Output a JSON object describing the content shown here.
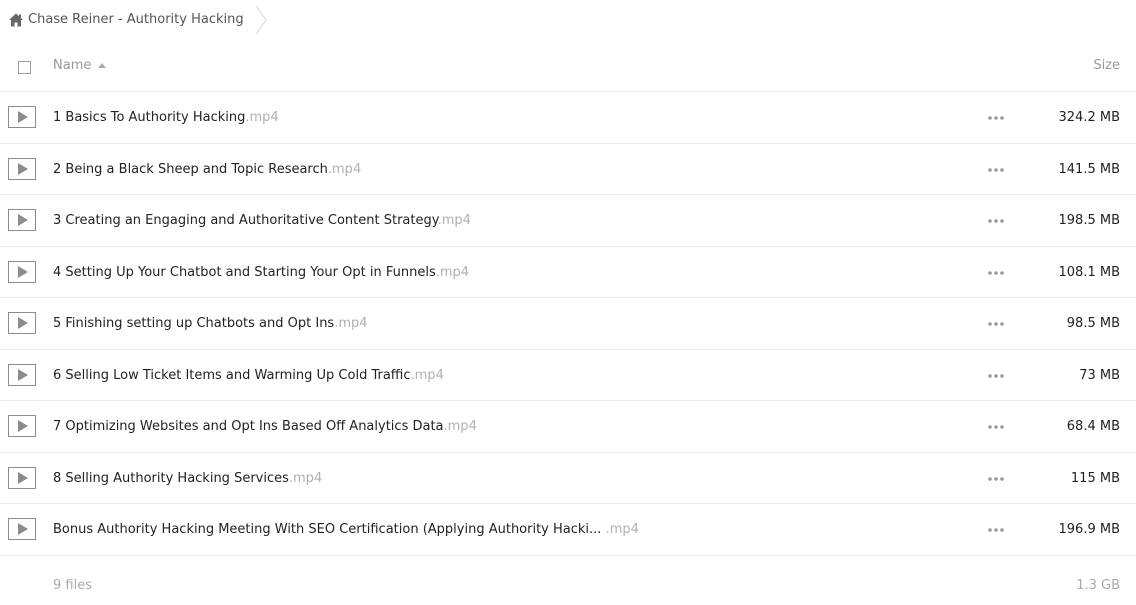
{
  "breadcrumb": {
    "home_icon": "home-icon",
    "folder_title": "Chase Reiner - Authority Hacking"
  },
  "header": {
    "name_label": "Name",
    "sort_direction": "ascending",
    "size_label": "Size"
  },
  "files": [
    {
      "name": "1 Basics To Authority Hacking",
      "ext": ".mp4",
      "size": "324.2 MB",
      "icon": "video-play-icon"
    },
    {
      "name": "2 Being a Black Sheep and Topic Research",
      "ext": ".mp4",
      "size": "141.5 MB",
      "icon": "video-play-icon"
    },
    {
      "name": "3 Creating an Engaging and Authoritative Content Strategy",
      "ext": ".mp4",
      "size": "198.5 MB",
      "icon": "video-play-icon"
    },
    {
      "name": "4 Setting Up Your Chatbot and Starting Your Opt in Funnels",
      "ext": ".mp4",
      "size": "108.1 MB",
      "icon": "video-play-icon"
    },
    {
      "name": "5 Finishing setting up Chatbots and Opt Ins",
      "ext": ".mp4",
      "size": "98.5 MB",
      "icon": "video-play-icon"
    },
    {
      "name": "6 Selling Low Ticket Items and Warming Up Cold Traffic",
      "ext": ".mp4",
      "size": "73 MB",
      "icon": "video-play-icon"
    },
    {
      "name": "7 Optimizing Websites and Opt Ins Based Off Analytics Data",
      "ext": ".mp4",
      "size": "68.4 MB",
      "icon": "video-play-icon"
    },
    {
      "name": "8 Selling Authority Hacking Services",
      "ext": ".mp4",
      "size": "115 MB",
      "icon": "video-play-icon"
    },
    {
      "name": "Bonus Authority Hacking Meeting With SEO Certification (Applying Authority Hacki... ",
      "ext": ".mp4",
      "size": "196.9 MB",
      "icon": "video-play-icon"
    }
  ],
  "footer": {
    "file_count": "9 files",
    "total_size": "1.3 GB"
  },
  "colors": {
    "text": "#222222",
    "muted": "#999999",
    "extension": "#b0b0b0",
    "divider": "#ebebeb",
    "icon": "#8c8c8c"
  }
}
